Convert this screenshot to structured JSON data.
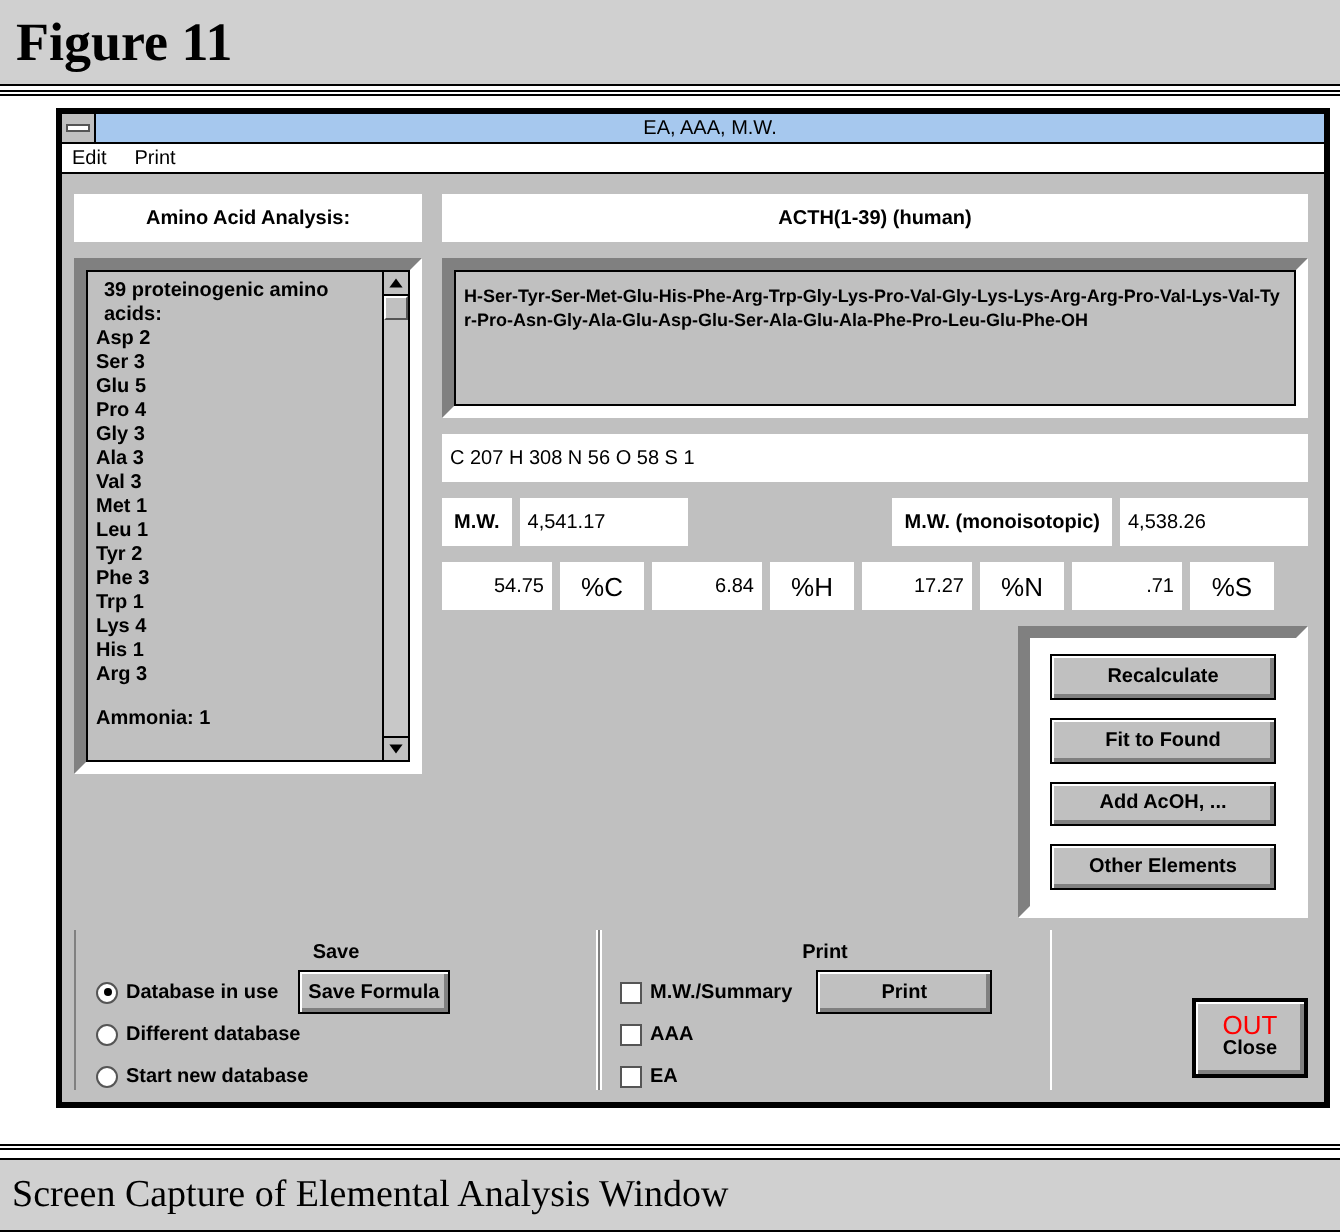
{
  "figure_title": "Figure 11",
  "window": {
    "title": "EA, AAA, M.W."
  },
  "menu": [
    {
      "label": "Edit"
    },
    {
      "label": "Print"
    }
  ],
  "analysis_label": "Amino Acid Analysis:",
  "peptide_name": "ACTH(1-39) (human)",
  "amino_acids": {
    "header": "39 proteinogenic amino acids:",
    "items": [
      "Asp 2",
      "Ser 3",
      "Glu 5",
      "Pro 4",
      "Gly 3",
      "Ala 3",
      "Val 3",
      "Met 1",
      "Leu 1",
      "Tyr 2",
      "Phe 3",
      "Trp 1",
      "Lys 4",
      "His 1",
      "Arg 3"
    ],
    "footer": "Ammonia: 1"
  },
  "sequence": "H-Ser-Tyr-Ser-Met-Glu-His-Phe-Arg-Trp-Gly-Lys-Pro-Val-Gly-Lys-Lys-Arg-Arg-Pro-Val-Lys-Val-Tyr-Pro-Asn-Gly-Ala-Glu-Asp-Glu-Ser-Ala-Glu-Ala-Phe-Pro-Leu-Glu-Phe-OH",
  "formula": "C 207 H 308 N 56 O 58 S 1",
  "mw": {
    "label": "M.W.",
    "value": "4,541.17"
  },
  "mw_mono": {
    "label": "M.W. (monoisotopic)",
    "value": "4,538.26"
  },
  "percentages": [
    {
      "value": "54.75",
      "label": "%C"
    },
    {
      "value": "6.84",
      "label": "%H"
    },
    {
      "value": "17.27",
      "label": "%N"
    },
    {
      "value": ".71",
      "label": "%S"
    }
  ],
  "actions": [
    "Recalculate",
    "Fit to Found",
    "Add AcOH, ...",
    "Other Elements"
  ],
  "save": {
    "title": "Save",
    "options": [
      {
        "label": "Database in use",
        "selected": true
      },
      {
        "label": "Different database",
        "selected": false
      },
      {
        "label": "Start new database",
        "selected": false
      }
    ],
    "button": "Save Formula"
  },
  "print": {
    "title": "Print",
    "options": [
      {
        "label": "M.W./Summary",
        "checked": false
      },
      {
        "label": "AAA",
        "checked": false
      },
      {
        "label": "EA",
        "checked": false
      }
    ],
    "button": "Print"
  },
  "close": {
    "mark": "OUT",
    "label": "Close"
  },
  "caption": "Screen Capture of Elemental Analysis Window"
}
